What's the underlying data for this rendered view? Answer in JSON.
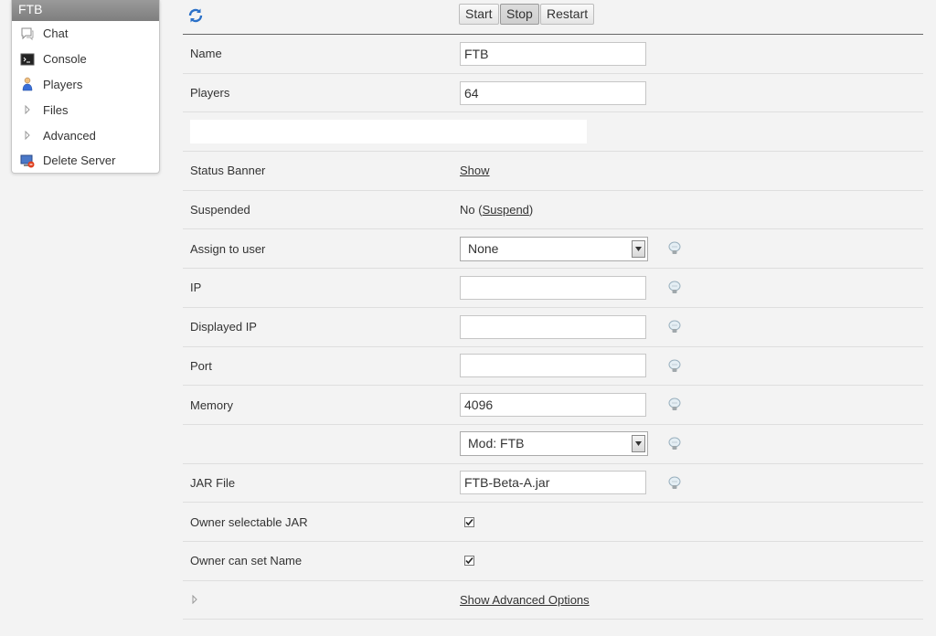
{
  "sidebar": {
    "title": "FTB",
    "items": [
      {
        "label": "Chat",
        "icon": "chat-icon"
      },
      {
        "label": "Console",
        "icon": "console-icon"
      },
      {
        "label": "Players",
        "icon": "players-icon"
      },
      {
        "label": "Files",
        "icon": "expand-arrow-icon"
      },
      {
        "label": "Advanced",
        "icon": "expand-arrow-icon"
      },
      {
        "label": "Delete Server",
        "icon": "delete-server-icon"
      }
    ]
  },
  "controls": {
    "start": "Start",
    "stop": "Stop",
    "restart": "Restart"
  },
  "form": {
    "name": {
      "label": "Name",
      "value": "FTB"
    },
    "players": {
      "label": "Players",
      "value": "64"
    },
    "status_banner": {
      "label": "Status Banner",
      "link": "Show"
    },
    "suspended": {
      "label": "Suspended",
      "value": "No",
      "link": "Suspend"
    },
    "assign_user": {
      "label": "Assign to user",
      "value": "None"
    },
    "ip": {
      "label": "IP",
      "value": ""
    },
    "displayed_ip": {
      "label": "Displayed IP",
      "value": ""
    },
    "port": {
      "label": "Port",
      "value": ""
    },
    "memory": {
      "label": "Memory",
      "value": "4096"
    },
    "mod": {
      "label": "",
      "value": "Mod: FTB"
    },
    "jar_file": {
      "label": "JAR File",
      "value": "FTB-Beta-A.jar"
    },
    "owner_jar": {
      "label": "Owner selectable JAR",
      "checked": true
    },
    "owner_name": {
      "label": "Owner can set Name",
      "checked": true
    },
    "advanced": {
      "link": "Show Advanced Options"
    }
  },
  "colors": {
    "background": "#f3f3f3",
    "sidebar_header": "#8a8a8a",
    "row_border": "#dedede"
  }
}
